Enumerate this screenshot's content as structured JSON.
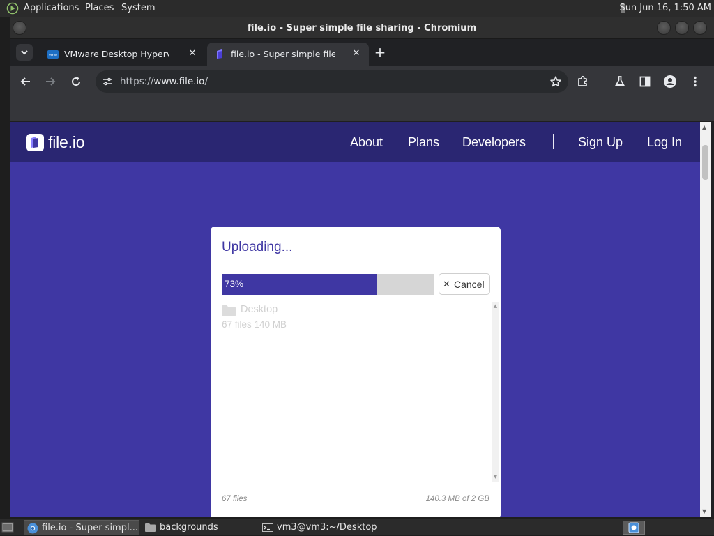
{
  "top_panel": {
    "menus": [
      "Applications",
      "Places",
      "System"
    ],
    "clock": "Sun Jun 16,  1:50 AM"
  },
  "window": {
    "title": "file.io - Super simple file sharing - Chromium"
  },
  "tabs": [
    {
      "title": "VMware Desktop Hypervisor",
      "favicon": "vmware-icon",
      "active": false
    },
    {
      "title": "file.io - Super simple file sharing",
      "favicon": "fileio-icon",
      "active": true
    }
  ],
  "toolbar": {
    "url_scheme": "https://",
    "url_host": "www.file.io",
    "url_path": "/"
  },
  "site": {
    "brand": "file.io",
    "nav": [
      "About",
      "Plans",
      "Developers",
      "Sign Up",
      "Log In"
    ]
  },
  "upload": {
    "heading": "Uploading...",
    "progress": 0.73,
    "progress_label": "73%",
    "cancel_label": "Cancel",
    "folder_name": "Desktop",
    "folder_meta": "67 files 140 MB",
    "files_count": "67 files",
    "storage": "140.3 MB of 2 GB"
  },
  "taskbar": {
    "items": [
      "file.io - Super simpl...",
      "backgrounds",
      "vm3@vm3:~/Desktop"
    ]
  },
  "colors": {
    "page_bg": "#3f37a3",
    "nav_bg": "#2a2672",
    "accent": "#3f37a3"
  }
}
